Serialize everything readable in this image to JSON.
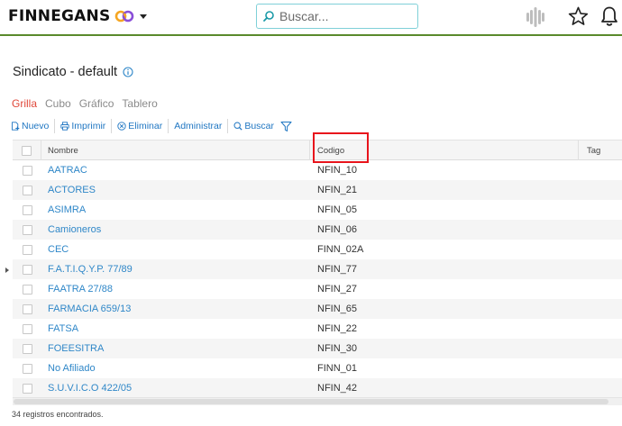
{
  "header": {
    "brand": "FINNEGANS",
    "search_placeholder": "Buscar...",
    "colors": {
      "brand_accent_left": "#f5a623",
      "brand_accent_right": "#8a4fd8",
      "topbar_line": "#5a8a2c"
    }
  },
  "page": {
    "title": "Sindicato - default"
  },
  "view_tabs": [
    {
      "label": "Grilla",
      "active": true
    },
    {
      "label": "Cubo",
      "active": false
    },
    {
      "label": "Gráfico",
      "active": false
    },
    {
      "label": "Tablero",
      "active": false
    }
  ],
  "toolbar": {
    "nuevo": "Nuevo",
    "imprimir": "Imprimir",
    "eliminar": "Eliminar",
    "administrar": "Administrar",
    "buscar": "Buscar"
  },
  "grid": {
    "columns": {
      "nombre": "Nombre",
      "codigo": "Codigo",
      "tag": "Tag"
    },
    "rows": [
      {
        "nombre": "AATRAC",
        "codigo": "NFIN_10"
      },
      {
        "nombre": "ACTORES",
        "codigo": "NFIN_21"
      },
      {
        "nombre": "ASIMRA",
        "codigo": "NFIN_05"
      },
      {
        "nombre": "Camioneros",
        "codigo": "NFIN_06"
      },
      {
        "nombre": "CEC",
        "codigo": "FINN_02A"
      },
      {
        "nombre": "F.A.T.I.Q.Y.P. 77/89",
        "codigo": "NFIN_77"
      },
      {
        "nombre": "FAATRA 27/88",
        "codigo": "NFIN_27"
      },
      {
        "nombre": "FARMACIA 659/13",
        "codigo": "NFIN_65"
      },
      {
        "nombre": "FATSA",
        "codigo": "NFIN_22"
      },
      {
        "nombre": "FOEESITRA",
        "codigo": "NFIN_30"
      },
      {
        "nombre": "No Afiliado",
        "codigo": "FINN_01"
      },
      {
        "nombre": "S.U.V.I.C.O 422/05",
        "codigo": "NFIN_42"
      }
    ]
  },
  "footer": {
    "count_text": "34 registros encontrados."
  }
}
